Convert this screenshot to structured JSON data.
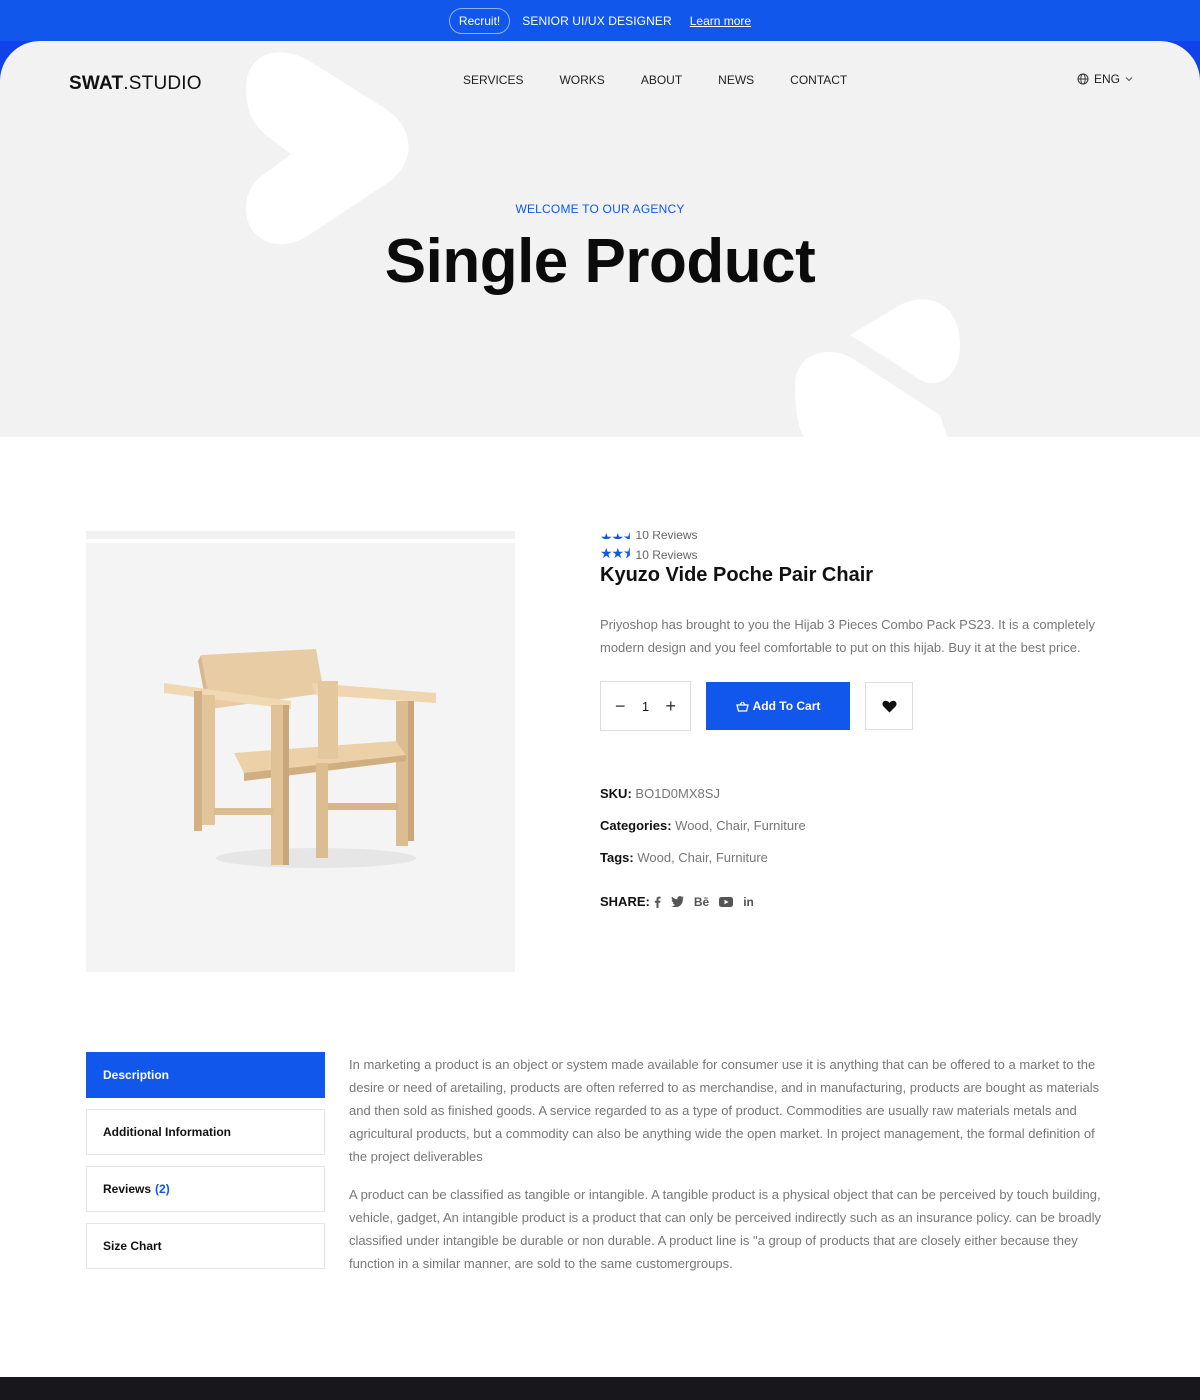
{
  "topbar": {
    "badge": "Recruit!",
    "role": "SENIOR UI/UX DESIGNER",
    "link": "Learn more"
  },
  "header": {
    "logo_bold": "SWAT",
    "logo_rest": ".STUDIO",
    "nav": [
      "SERVICES",
      "WORKS",
      "ABOUT",
      "NEWS",
      "CONTACT"
    ],
    "language": "ENG"
  },
  "hero": {
    "eyebrow": "WELCOME TO OUR AGENCY",
    "title": "Single Product"
  },
  "product": {
    "reviews_text": "10 Reviews",
    "rating": 2.5,
    "title": "Kyuzo Vide Poche Pair Chair",
    "description": "Priyoshop has brought to you the Hijab 3 Pieces Combo Pack PS23. It is a completely modern design and you feel comfortable to put on this hijab. Buy it at the best price.",
    "quantity": "1",
    "add_to_cart": "Add To Cart",
    "sku_label": "SKU:",
    "sku": "BO1D0MX8SJ",
    "categories_label": "Categories:",
    "categories": "Wood, Chair, Furniture",
    "tags_label": "Tags:",
    "tags": "Wood, Chair, Furniture",
    "share_label": "SHARE:",
    "share_icons": [
      "facebook-icon",
      "twitter-icon",
      "behance-icon",
      "youtube-icon",
      "linkedin-icon"
    ],
    "behance_text": "Bē",
    "linkedin_text": "in"
  },
  "tabs": [
    {
      "label": "Description",
      "active": true
    },
    {
      "label": "Additional Information"
    },
    {
      "label": "Reviews",
      "count": "(2)"
    },
    {
      "label": "Size Chart"
    }
  ],
  "description_paragraphs": [
    "In marketing a product is an object or system made available for consumer use it is anything that can be offered to a market to the desire or need of aretailing, products are often referred to as merchandise, and in manufacturing, products are bought as materials and then sold as finished goods. A service regarded to as a type of product. Commodities are usually raw materials metals and agricultural products, but a commodity can also be anything wide the open market. In project management, the formal definition of the project deliverables",
    "A product can be classified as tangible or intangible. A tangible product is a physical object that can be perceived by touch building, vehicle, gadget, An intangible product is a product that can only be perceived indirectly such as an insurance policy. can be broadly classified under intangible be durable or non durable. A product line is \"a group of products that are closely either because they function in a similar manner, are sold to the same customergroups."
  ],
  "colors": {
    "accent": "#1157ec",
    "hero_bg": "#f2f2f2",
    "footer": "#18181c"
  }
}
